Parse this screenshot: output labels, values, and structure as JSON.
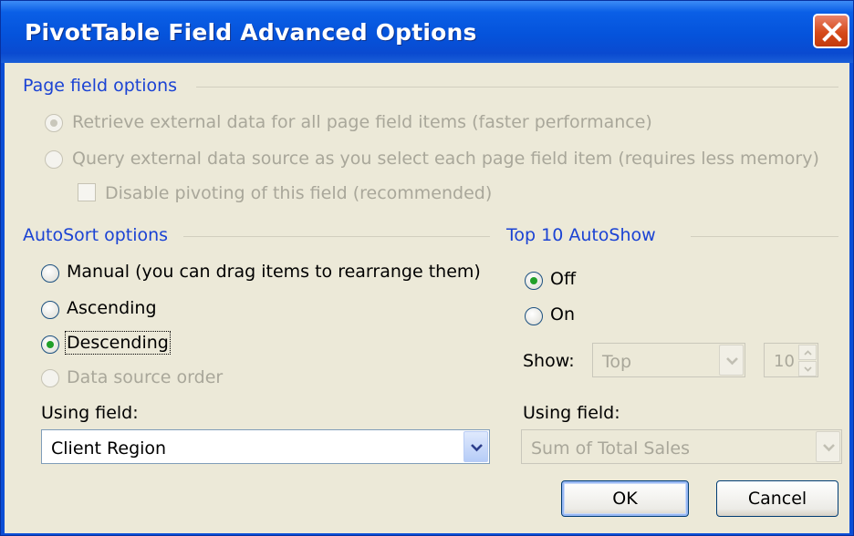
{
  "window": {
    "title": "PivotTable Field Advanced Options"
  },
  "page_field": {
    "heading": "Page field options",
    "options": [
      {
        "label": "Retrieve external data for all page field items (faster performance)",
        "selected": true,
        "enabled": false
      },
      {
        "label": "Query external data source as you select each page field item (requires less memory)",
        "selected": false,
        "enabled": false
      }
    ],
    "disable_pivoting_label": "Disable pivoting of this field (recommended)"
  },
  "autosort": {
    "heading": "AutoSort options",
    "options": [
      {
        "label": "Manual (you can drag items to rearrange them)",
        "selected": false,
        "enabled": true
      },
      {
        "label": "Ascending",
        "selected": false,
        "enabled": true
      },
      {
        "label": "Descending",
        "selected": true,
        "enabled": true
      },
      {
        "label": "Data source order",
        "selected": false,
        "enabled": false
      }
    ],
    "using_field_label": "Using field:",
    "using_field_value": "Client Region"
  },
  "top10": {
    "heading": "Top 10 AutoShow",
    "options": [
      {
        "label": "Off",
        "selected": true
      },
      {
        "label": "On",
        "selected": false
      }
    ],
    "show_label": "Show:",
    "show_value": "Top",
    "count_value": "10",
    "using_field_label": "Using field:",
    "using_field_value": "Sum of Total Sales"
  },
  "buttons": {
    "ok": "OK",
    "cancel": "Cancel"
  },
  "colors": {
    "title_bar": "#0553db",
    "group_heading": "#1b43d4",
    "face": "#ece9d8",
    "close": "#d64a1a",
    "radio_dot": "#22a02a"
  },
  "icons": {
    "close": "close-icon",
    "dropdown": "chevron-down-icon",
    "spin_up": "chevron-up-icon",
    "spin_down": "chevron-down-icon"
  }
}
